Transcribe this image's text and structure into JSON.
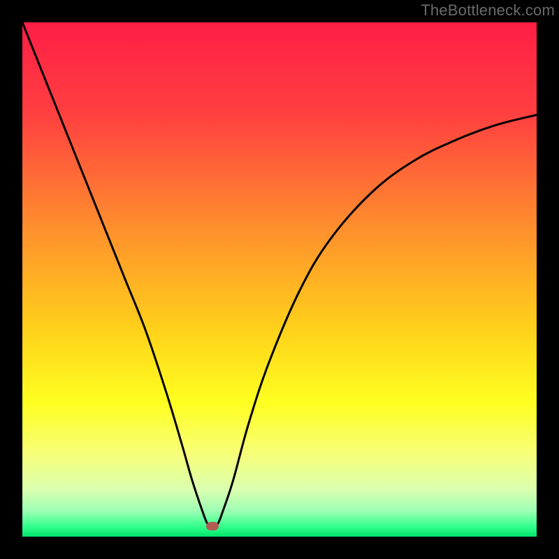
{
  "watermark": "TheBottleneck.com",
  "colors": {
    "frame": "#000000",
    "marker": "#b35a55",
    "curve": "#000000",
    "gradient_stops": [
      {
        "pct": 0,
        "color": "#ff1e46"
      },
      {
        "pct": 18,
        "color": "#ff4040"
      },
      {
        "pct": 40,
        "color": "#ff8f2d"
      },
      {
        "pct": 60,
        "color": "#ffd21a"
      },
      {
        "pct": 74,
        "color": "#ffff20"
      },
      {
        "pct": 84,
        "color": "#f7ff7a"
      },
      {
        "pct": 91,
        "color": "#d9ffb0"
      },
      {
        "pct": 95,
        "color": "#9dffb4"
      },
      {
        "pct": 98,
        "color": "#34ff8d"
      },
      {
        "pct": 100,
        "color": "#00e56a"
      }
    ]
  },
  "chart_data": {
    "type": "line",
    "title": "",
    "xlabel": "",
    "ylabel": "",
    "xlim": [
      0,
      100
    ],
    "ylim": [
      0,
      100
    ],
    "annotations": [
      "marker at (37, 2)"
    ],
    "series": [
      {
        "name": "bottleneck-curve",
        "x": [
          0,
          4,
          8,
          12,
          16,
          20,
          24,
          28,
          31,
          33,
          35,
          36,
          37,
          38,
          39,
          41,
          44,
          48,
          54,
          60,
          68,
          76,
          84,
          92,
          100
        ],
        "y": [
          100,
          90,
          80,
          70,
          60,
          50,
          40,
          28,
          18,
          11,
          5,
          2.5,
          1.8,
          2.5,
          5,
          11,
          22,
          34,
          48,
          58,
          67,
          73,
          77,
          80,
          82
        ]
      }
    ],
    "marker": {
      "x": 37,
      "y": 2
    }
  }
}
